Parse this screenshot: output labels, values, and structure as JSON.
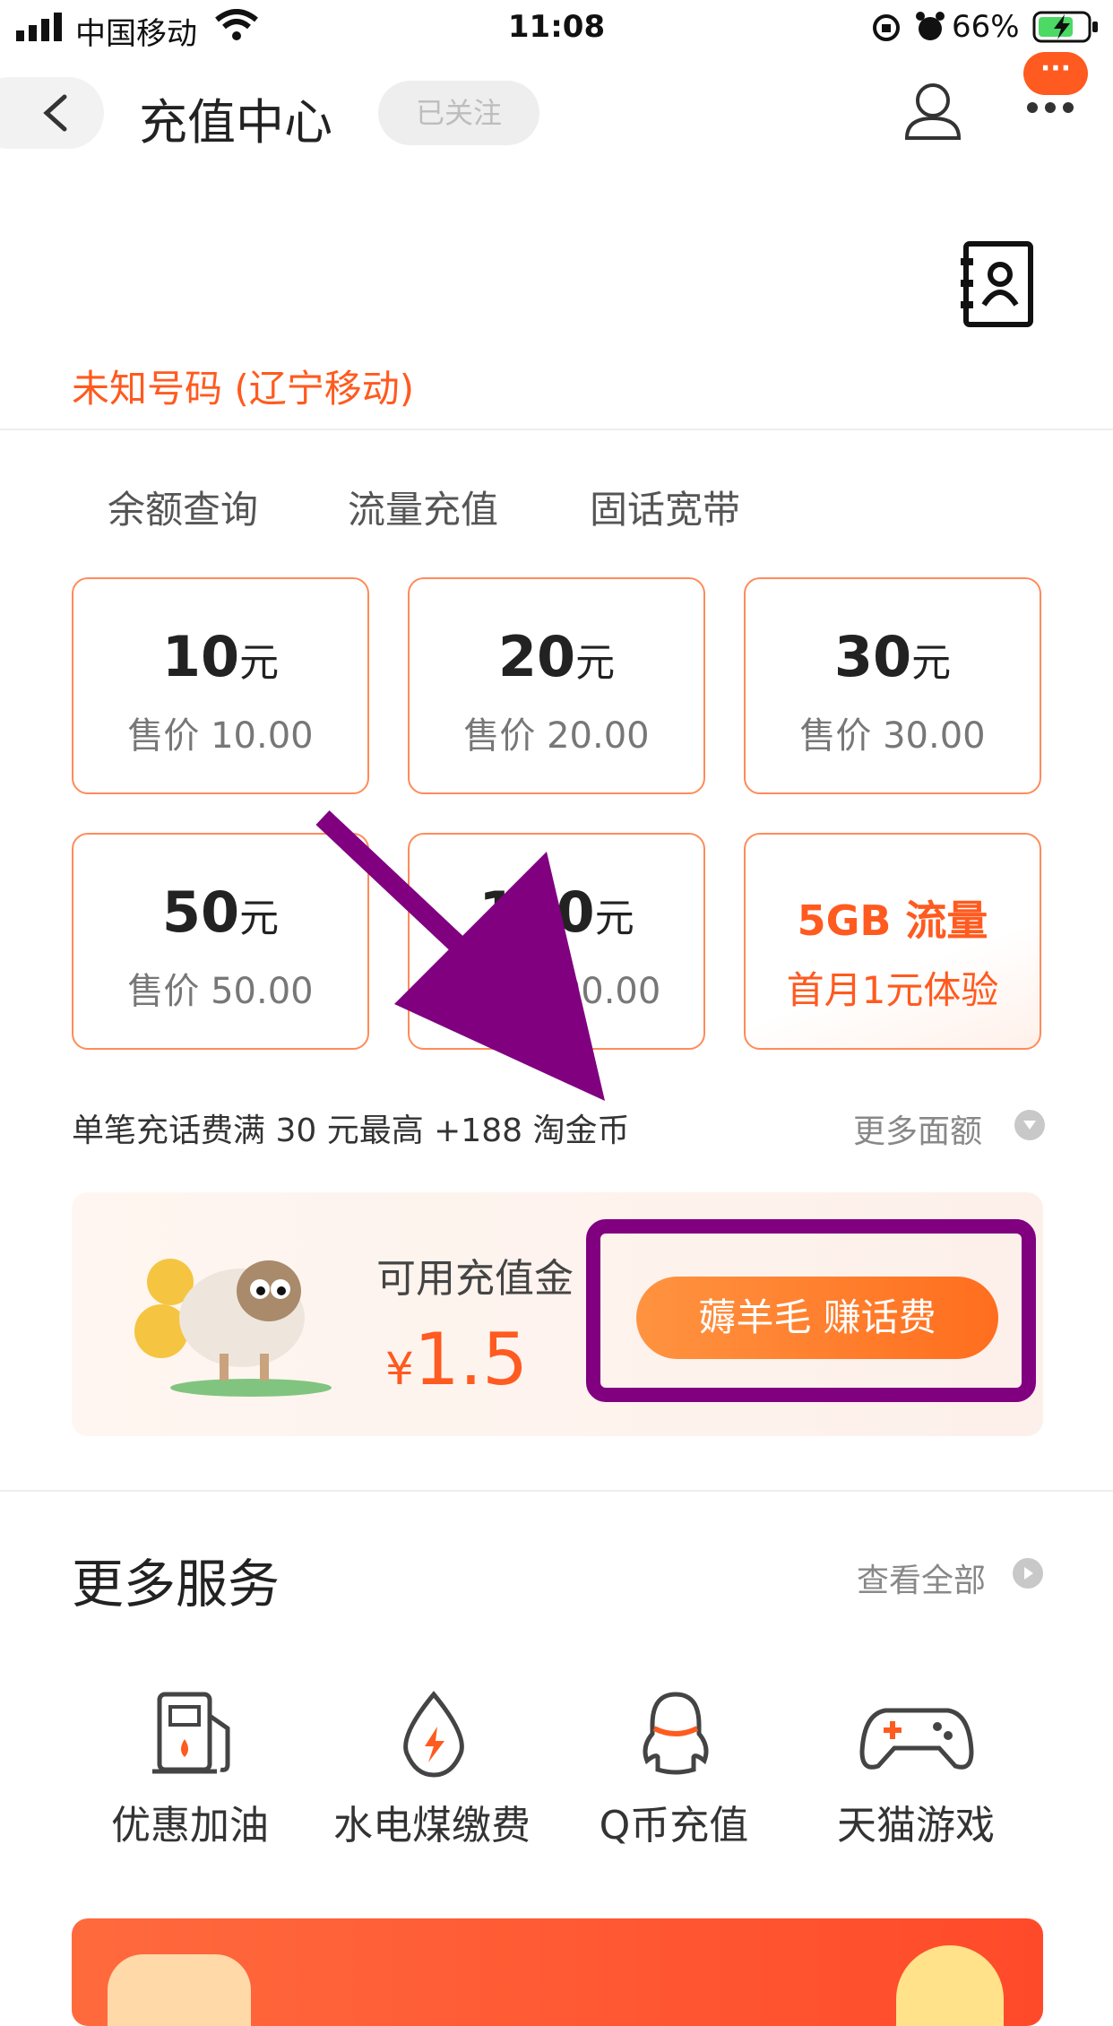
{
  "status_bar": {
    "carrier": "中国移动",
    "time": "11:08",
    "battery": "66%"
  },
  "nav": {
    "title": "充值中心",
    "follow_label": "已关注",
    "message_badge": "···"
  },
  "phone": {
    "label": "未知号码 (辽宁移动)"
  },
  "tabs": [
    "余额查询",
    "流量充值",
    "固话宽带"
  ],
  "cards": [
    {
      "amount": "10",
      "unit": "元",
      "price": "售价 10.00"
    },
    {
      "amount": "20",
      "unit": "元",
      "price": "售价 20.00"
    },
    {
      "amount": "30",
      "unit": "元",
      "price": "售价 30.00"
    },
    {
      "amount": "50",
      "unit": "元",
      "price": "售价 50.00"
    },
    {
      "amount": "100",
      "unit": "元",
      "price": "售价 100.00"
    },
    {
      "promo_title": "5GB 流量",
      "promo_sub": "首月1元体验"
    }
  ],
  "promo": {
    "text": "单笔充话费满 30 元最高 +188 淘金币",
    "more_amounts": "更多面额"
  },
  "gold": {
    "label": "可用充值金",
    "currency": "¥",
    "value": "1.5",
    "button": "薅羊毛 赚话费"
  },
  "more_services": {
    "title": "更多服务",
    "view_all": "查看全部",
    "items": [
      {
        "label": "优惠加油",
        "icon": "gas-pump-icon"
      },
      {
        "label": "水电煤缴费",
        "icon": "utility-drop-icon"
      },
      {
        "label": "Q币充值",
        "icon": "qq-penguin-icon"
      },
      {
        "label": "天猫游戏",
        "icon": "gamepad-icon"
      }
    ]
  },
  "colors": {
    "accent": "#ff5a1f",
    "card_border": "#ff8b5a",
    "annotation": "#800080"
  }
}
